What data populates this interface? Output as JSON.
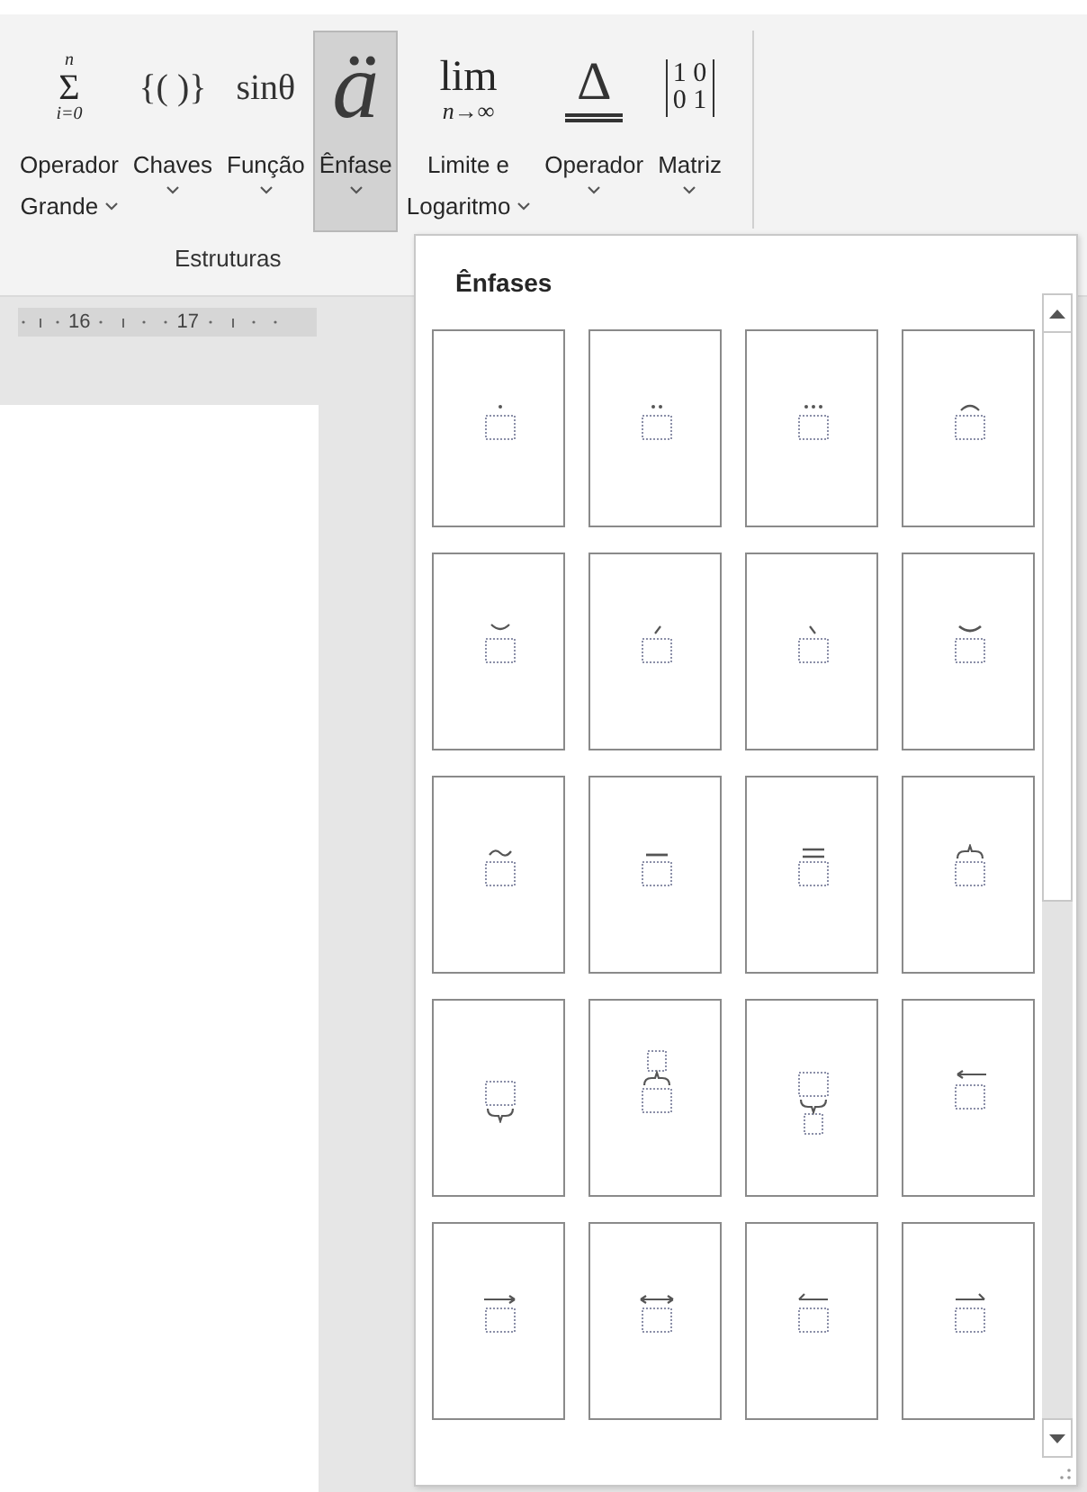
{
  "ribbon": {
    "buttons": [
      {
        "glyph": {
          "kind": "sum",
          "text": "Σ",
          "top": "n",
          "bottom": "i=0"
        },
        "label_lines": [
          "Operador",
          "Grande"
        ],
        "selected": false
      },
      {
        "glyph": {
          "kind": "plain",
          "text": "{( )}"
        },
        "label_lines": [
          "Chaves"
        ],
        "selected": false
      },
      {
        "glyph": {
          "kind": "plain",
          "text": "sinθ"
        },
        "label_lines": [
          "Função"
        ],
        "selected": false
      },
      {
        "glyph": {
          "kind": "accent",
          "text": "ä"
        },
        "label_lines": [
          "Ênfase"
        ],
        "selected": true
      },
      {
        "glyph": {
          "kind": "limit",
          "text": "lim",
          "bottom": "n→∞"
        },
        "label_lines": [
          "Limite e",
          "Logaritmo"
        ],
        "selected": false
      },
      {
        "glyph": {
          "kind": "delta",
          "text": "Δ"
        },
        "label_lines": [
          "Operador"
        ],
        "selected": false
      },
      {
        "glyph": {
          "kind": "matrix",
          "rows": [
            "1 0",
            "0 1"
          ]
        },
        "label_lines": [
          "Matriz"
        ],
        "selected": false
      }
    ],
    "group_label": "Estruturas"
  },
  "ruler": {
    "numbers": [
      "16",
      "17"
    ]
  },
  "gallery": {
    "title": "Ênfases",
    "items": [
      {
        "kind": "dot"
      },
      {
        "kind": "double-dot"
      },
      {
        "kind": "triple-dot"
      },
      {
        "kind": "hat"
      },
      {
        "kind": "check"
      },
      {
        "kind": "acute"
      },
      {
        "kind": "grave"
      },
      {
        "kind": "breve"
      },
      {
        "kind": "tilde"
      },
      {
        "kind": "bar"
      },
      {
        "kind": "double-bar"
      },
      {
        "kind": "overbrace"
      },
      {
        "kind": "underbrace"
      },
      {
        "kind": "group-overbrace"
      },
      {
        "kind": "group-underbrace"
      },
      {
        "kind": "left-arrow"
      },
      {
        "kind": "right-arrow"
      },
      {
        "kind": "left-right-arrow"
      },
      {
        "kind": "left-harpoon"
      },
      {
        "kind": "right-harpoon"
      }
    ]
  }
}
